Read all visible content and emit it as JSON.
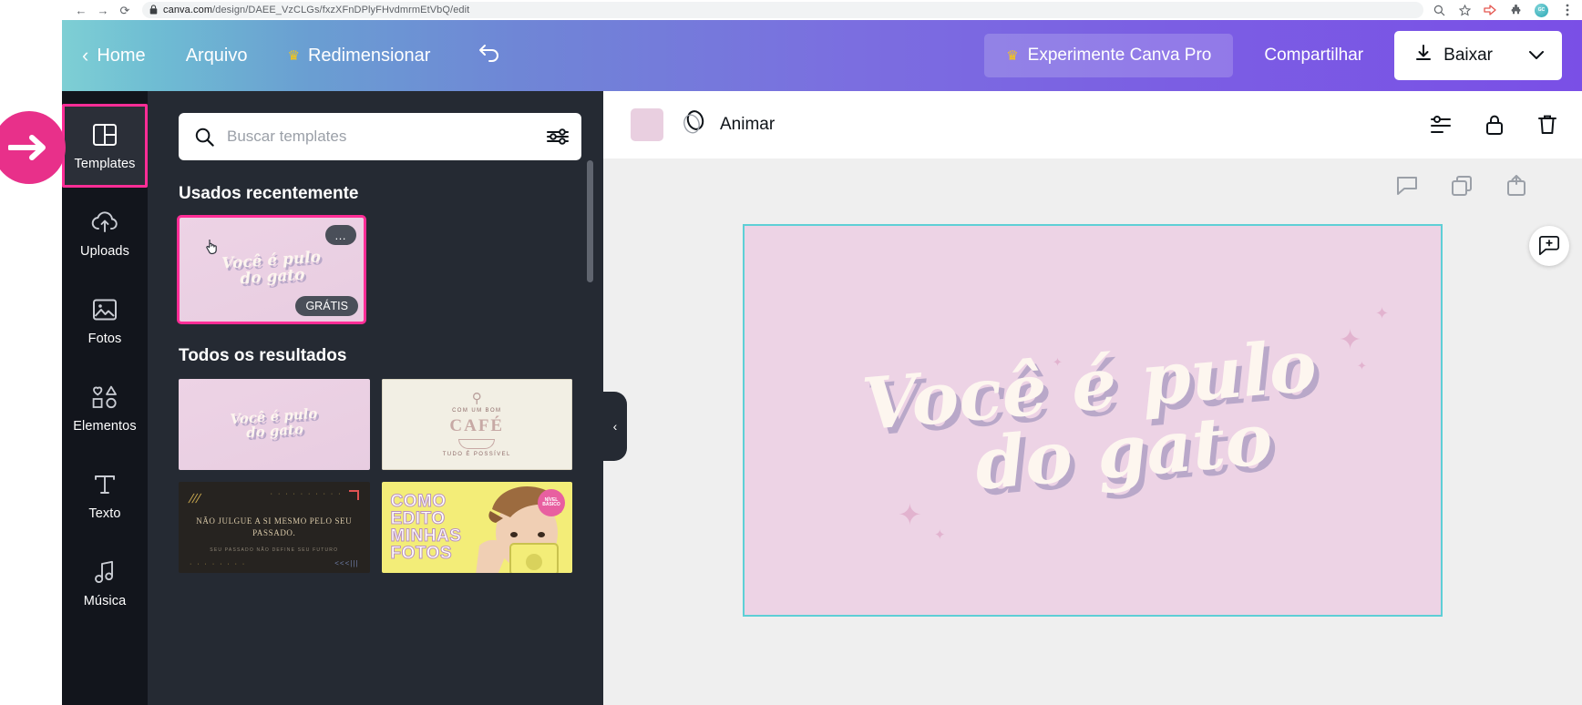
{
  "browser": {
    "url_domain": "canva.com",
    "url_path": "/design/DAEE_VzCLGs/fxzXFnDPlyFHvdmrmEtVbQ/edit",
    "back_icon": "←",
    "forward_icon": "→",
    "reload_icon": "⟳",
    "lock_icon": "🔒",
    "icons": [
      "search-icon",
      "bookmark-star-icon",
      "extension-arrow-icon",
      "puzzle-extension-icon",
      "profile-avatar",
      "kebab-menu-icon"
    ],
    "avatar_label": "GC"
  },
  "topbar": {
    "home_label": "Home",
    "arquivo_label": "Arquivo",
    "redimensionar_label": "Redimensionar",
    "crown_icon": "♛",
    "back_chevron": "‹",
    "undo_icon": "↺",
    "pro_label": "Experimente Canva Pro",
    "share_label": "Compartilhar",
    "download_label": "Baixar",
    "download_icon": "↓",
    "caret_icon": "⌄",
    "gradient_start": "#7ecfd4",
    "gradient_end": "#7a4fe6"
  },
  "rail": {
    "items": [
      {
        "label": "Templates",
        "icon": "templates-icon",
        "active": true,
        "highlighted": true
      },
      {
        "label": "Uploads",
        "icon": "upload-cloud-icon",
        "active": false,
        "highlighted": false
      },
      {
        "label": "Fotos",
        "icon": "photo-icon",
        "active": false,
        "highlighted": false
      },
      {
        "label": "Elementos",
        "icon": "shapes-icon",
        "active": false,
        "highlighted": false
      },
      {
        "label": "Texto",
        "icon": "text-t-icon",
        "active": false,
        "highlighted": false
      },
      {
        "label": "Música",
        "icon": "music-note-icon",
        "active": false,
        "highlighted": false
      }
    ],
    "highlight_color": "#ff2d96"
  },
  "panel": {
    "search_placeholder": "Buscar templates",
    "search_value": "",
    "search_icon": "search-icon",
    "filter_icon": "filter-sliders-icon",
    "recent_title": "Usados recentemente",
    "all_title": "Todos os resultados",
    "recent_card": {
      "line1": "Você é pulo",
      "line2": "do gato",
      "badge": "GRÁTIS",
      "menu_icon": "…",
      "border_color": "#ff2d96"
    },
    "results": [
      {
        "type": "pink-script",
        "line1": "Você é pulo",
        "line2": "do gato"
      },
      {
        "type": "cafe",
        "top": "COM UM BOM",
        "big": "CAFÉ",
        "bottom": "TUDO É POSSÍVEL"
      },
      {
        "type": "dark-quote",
        "text": "NÃO JULGUE A SI MESMO PELO SEU PASSADO.",
        "sub": "SEU PASSADO NÃO DEFINE SEU FUTURO"
      },
      {
        "type": "yellow-photo",
        "line1": "COMO",
        "line2": "EDITO",
        "line3": "MINHAS",
        "line4": "FOTOS",
        "badge": "NÍVEL BÁSICO"
      }
    ]
  },
  "collapse": {
    "icon": "‹"
  },
  "editor": {
    "swatch_color": "#e9cfe0",
    "animar_label": "Animar",
    "animar_icon": "animate-circle-icon",
    "toolbar_icons": [
      "position-icon",
      "lock-icon",
      "trash-icon"
    ],
    "page_tools": [
      "notes-icon",
      "duplicate-page-icon",
      "add-page-icon"
    ],
    "comment_icon": "comment-plus-icon",
    "canvas": {
      "background": "#edd3e5",
      "border_color": "#5ecfd6",
      "line1": "Você é pulo",
      "line2": "do gato"
    }
  },
  "annotation": {
    "arrow_icon": "➜",
    "color": "#e8308a"
  }
}
